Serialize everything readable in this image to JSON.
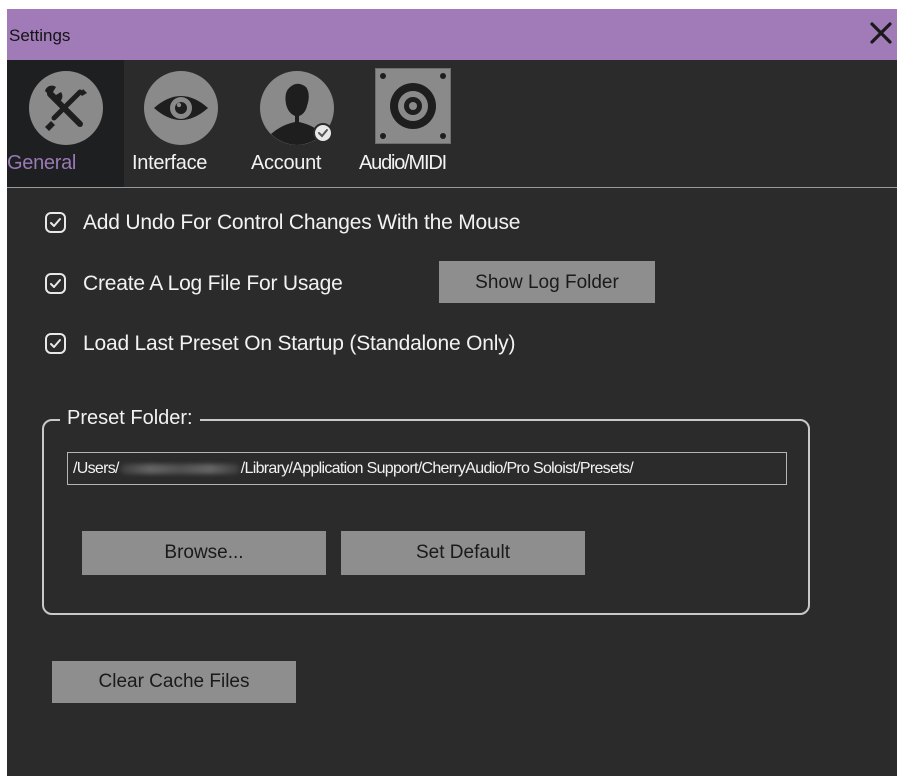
{
  "window": {
    "title": "Settings",
    "close_icon": "close-icon"
  },
  "tabs": [
    {
      "label": "General",
      "icon": "wrench-screwdriver-icon",
      "active": true
    },
    {
      "label": "Interface",
      "icon": "eye-icon",
      "active": false
    },
    {
      "label": "Account",
      "icon": "user-icon",
      "active": false
    },
    {
      "label": "Audio/MIDI",
      "icon": "speaker-icon",
      "active": false
    }
  ],
  "options": [
    {
      "label": "Add Undo For Control Changes With the Mouse",
      "checked": true
    },
    {
      "label": "Create A Log File For Usage",
      "checked": true
    },
    {
      "label": "Load Last Preset On Startup (Standalone Only)",
      "checked": true
    }
  ],
  "buttons": {
    "show_log_folder": "Show Log Folder",
    "browse": "Browse...",
    "set_default": "Set Default",
    "clear_cache": "Clear Cache Files"
  },
  "preset_folder": {
    "legend": "Preset Folder:",
    "path_prefix": "/Users/",
    "path_suffix": "/Library/Application Support/CherryAudio/Pro Soloist/Presets/"
  },
  "colors": {
    "accent": "#9a79b5",
    "titlebar": "#a07bb8",
    "background": "#2b2b2c",
    "button": "#8e8e8e"
  }
}
